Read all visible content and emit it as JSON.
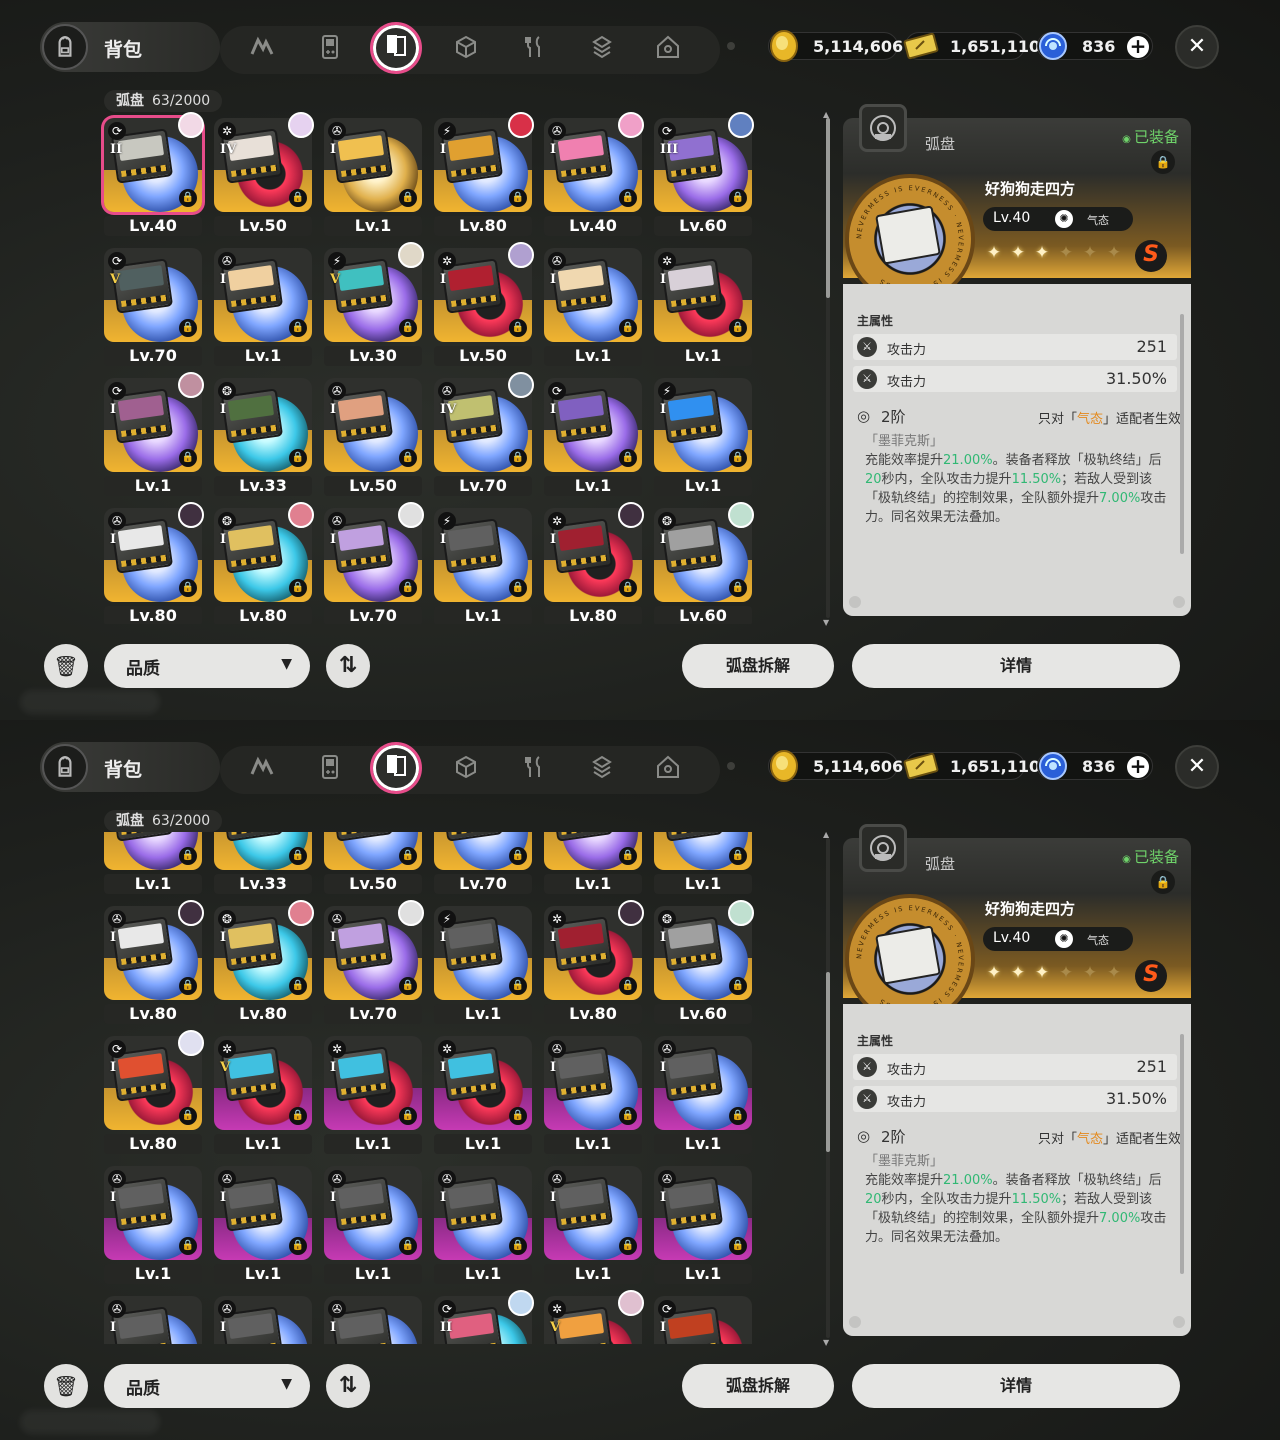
{
  "header": {
    "bag_title": "背包",
    "active_tab_index": 2,
    "tabs": [
      {
        "name": "tab-agents",
        "icon": "n-logo-icon"
      },
      {
        "name": "tab-gameboy",
        "icon": "handheld-console-icon"
      },
      {
        "name": "tab-discs",
        "icon": "disc-drive-icon"
      },
      {
        "name": "tab-materials",
        "icon": "cube-icon"
      },
      {
        "name": "tab-food",
        "icon": "fork-knife-icon"
      },
      {
        "name": "tab-cards",
        "icon": "card-stack-icon"
      },
      {
        "name": "tab-home",
        "icon": "house-icon"
      }
    ]
  },
  "currencies": [
    {
      "name": "coins",
      "icon": "gold-coin-icon",
      "value": "5,114,606"
    },
    {
      "name": "tickets",
      "icon": "ticket-icon",
      "value": "1,651,110"
    },
    {
      "name": "polychrome",
      "icon": "blue-orb-icon",
      "value": "836",
      "has_plus": true
    }
  ],
  "inventory": {
    "label": "弧盘",
    "count": "63/2000"
  },
  "panels": [
    {
      "id": "top",
      "grid_offset_rows": 0,
      "grid_row_shift": 0,
      "scroll_thumb_fraction": 0.0,
      "items": [
        {
          "level": "Lv.40",
          "tier": "II",
          "rank": "S",
          "attr": "⟳",
          "color": "blue",
          "art": "#c8c8c0",
          "avatar": "#f2d9e6",
          "selected": true
        },
        {
          "level": "Lv.50",
          "tier": "IV",
          "rank": "S",
          "attr": "✲",
          "color": "red",
          "art": "#e8e0d8",
          "avatar": "#e6d2f0"
        },
        {
          "level": "Lv.1",
          "tier": "I",
          "rank": "S",
          "attr": "✇",
          "color": "gold",
          "art": "#f0c050",
          "avatar": ""
        },
        {
          "level": "Lv.80",
          "tier": "I",
          "rank": "S",
          "attr": "⚡",
          "color": "blue",
          "art": "#e0a030",
          "avatar": "#d83048"
        },
        {
          "level": "Lv.40",
          "tier": "I",
          "rank": "S",
          "attr": "✇",
          "color": "blue",
          "art": "#f080b0",
          "avatar": "#f0a0c8"
        },
        {
          "level": "Lv.60",
          "tier": "III",
          "rank": "S",
          "attr": "⟳",
          "color": "purple",
          "art": "#9070d0",
          "avatar": "#6080c0"
        },
        {
          "level": "Lv.70",
          "tier": "V",
          "rank": "S",
          "attr": "⟳",
          "color": "blue",
          "art": "#506060",
          "avatar": ""
        },
        {
          "level": "Lv.1",
          "tier": "I",
          "rank": "S",
          "attr": "✇",
          "color": "blue",
          "art": "#f0d0a0",
          "avatar": ""
        },
        {
          "level": "Lv.30",
          "tier": "V",
          "rank": "S",
          "attr": "⚡",
          "color": "purple",
          "art": "#40c0c0",
          "avatar": "#e0d8c8"
        },
        {
          "level": "Lv.50",
          "tier": "I",
          "rank": "S",
          "attr": "✲",
          "color": "red",
          "art": "#b02030",
          "avatar": "#b0a0d0"
        },
        {
          "level": "Lv.1",
          "tier": "I",
          "rank": "S",
          "attr": "✇",
          "color": "blue",
          "art": "#f0d8b0",
          "avatar": ""
        },
        {
          "level": "Lv.1",
          "tier": "I",
          "rank": "S",
          "attr": "✲",
          "color": "red",
          "art": "#d8d0d8",
          "avatar": ""
        },
        {
          "level": "Lv.1",
          "tier": "I",
          "rank": "S",
          "attr": "⟳",
          "color": "purple",
          "art": "#a06090",
          "avatar": "#c090a0"
        },
        {
          "level": "Lv.33",
          "tier": "I",
          "rank": "S",
          "attr": "❂",
          "color": "teal",
          "art": "#507040",
          "avatar": ""
        },
        {
          "level": "Lv.50",
          "tier": "I",
          "rank": "S",
          "attr": "✇",
          "color": "blue",
          "art": "#e0a080",
          "avatar": ""
        },
        {
          "level": "Lv.70",
          "tier": "IV",
          "rank": "S",
          "attr": "✇",
          "color": "blue",
          "art": "#c0c070",
          "avatar": "#8090a0"
        },
        {
          "level": "Lv.1",
          "tier": "I",
          "rank": "S",
          "attr": "⟳",
          "color": "purple",
          "art": "#8060c0",
          "avatar": ""
        },
        {
          "level": "Lv.1",
          "tier": "I",
          "rank": "S",
          "attr": "⚡",
          "color": "blue",
          "art": "#3090f0",
          "avatar": ""
        },
        {
          "level": "Lv.80",
          "tier": "I",
          "rank": "S",
          "attr": "✇",
          "color": "blue",
          "art": "#e8e8e8",
          "avatar": "#403040"
        },
        {
          "level": "Lv.80",
          "tier": "I",
          "rank": "S",
          "attr": "❂",
          "color": "teal",
          "art": "#e0c060",
          "avatar": "#e08090"
        },
        {
          "level": "Lv.70",
          "tier": "I",
          "rank": "S",
          "attr": "✇",
          "color": "purple",
          "art": "#c0a0e0",
          "avatar": "#e0e0e0"
        },
        {
          "level": "Lv.1",
          "tier": "I",
          "rank": "S",
          "attr": "⚡",
          "color": "blue",
          "art": "#606060",
          "avatar": ""
        },
        {
          "level": "Lv.80",
          "tier": "I",
          "rank": "S",
          "attr": "✲",
          "color": "red",
          "art": "#a02030",
          "avatar": "#403040"
        },
        {
          "level": "Lv.60",
          "tier": "I",
          "rank": "S",
          "attr": "❂",
          "color": "blue",
          "art": "#a0a0a0",
          "avatar": "#c0e0d0"
        }
      ]
    },
    {
      "id": "bottom",
      "grid_offset_rows": 2,
      "scroll_thumb_fraction": 0.42,
      "items": [
        {
          "level": "Lv.1",
          "tier": "I",
          "rank": "S",
          "attr": "⟳",
          "color": "purple",
          "art": "#a06090",
          "avatar": ""
        },
        {
          "level": "Lv.33",
          "tier": "I",
          "rank": "S",
          "attr": "❂",
          "color": "teal",
          "art": "#507040",
          "avatar": ""
        },
        {
          "level": "Lv.50",
          "tier": "I",
          "rank": "S",
          "attr": "✇",
          "color": "blue",
          "art": "#e0a080",
          "avatar": ""
        },
        {
          "level": "Lv.70",
          "tier": "IV",
          "rank": "S",
          "attr": "✇",
          "color": "blue",
          "art": "#c0c070",
          "avatar": ""
        },
        {
          "level": "Lv.1",
          "tier": "I",
          "rank": "S",
          "attr": "⟳",
          "color": "purple",
          "art": "#8060c0",
          "avatar": ""
        },
        {
          "level": "Lv.1",
          "tier": "I",
          "rank": "S",
          "attr": "⚡",
          "color": "blue",
          "art": "#3090f0",
          "avatar": ""
        },
        {
          "level": "Lv.80",
          "tier": "I",
          "rank": "S",
          "attr": "✇",
          "color": "blue",
          "art": "#e8e8e8",
          "avatar": "#403040"
        },
        {
          "level": "Lv.80",
          "tier": "I",
          "rank": "S",
          "attr": "❂",
          "color": "teal",
          "art": "#e0c060",
          "avatar": "#e08090"
        },
        {
          "level": "Lv.70",
          "tier": "I",
          "rank": "S",
          "attr": "✇",
          "color": "purple",
          "art": "#c0a0e0",
          "avatar": "#e0e0e0"
        },
        {
          "level": "Lv.1",
          "tier": "I",
          "rank": "S",
          "attr": "⚡",
          "color": "blue",
          "art": "#606060",
          "avatar": ""
        },
        {
          "level": "Lv.80",
          "tier": "I",
          "rank": "S",
          "attr": "✲",
          "color": "red",
          "art": "#a02030",
          "avatar": "#403040"
        },
        {
          "level": "Lv.60",
          "tier": "I",
          "rank": "S",
          "attr": "❂",
          "color": "blue",
          "art": "#a0a0a0",
          "avatar": "#c0e0d0"
        },
        {
          "level": "Lv.80",
          "tier": "I",
          "rank": "S",
          "attr": "⟳",
          "color": "red",
          "art": "#e05030",
          "avatar": "#e0e0f0"
        },
        {
          "level": "Lv.1",
          "tier": "V",
          "rank": "A",
          "attr": "✲",
          "color": "red",
          "art": "#40c0e0",
          "avatar": ""
        },
        {
          "level": "Lv.1",
          "tier": "I",
          "rank": "A",
          "attr": "✲",
          "color": "red",
          "art": "#40c0e0",
          "avatar": ""
        },
        {
          "level": "Lv.1",
          "tier": "I",
          "rank": "A",
          "attr": "✲",
          "color": "red",
          "art": "#40c0e0",
          "avatar": ""
        },
        {
          "level": "Lv.1",
          "tier": "I",
          "rank": "A",
          "attr": "✇",
          "color": "blue",
          "art": "#606060",
          "avatar": ""
        },
        {
          "level": "Lv.1",
          "tier": "I",
          "rank": "A",
          "attr": "✇",
          "color": "blue",
          "art": "#606060",
          "avatar": ""
        },
        {
          "level": "Lv.1",
          "tier": "I",
          "rank": "A",
          "attr": "✇",
          "color": "blue",
          "art": "#606060",
          "avatar": ""
        },
        {
          "level": "Lv.1",
          "tier": "I",
          "rank": "A",
          "attr": "✇",
          "color": "blue",
          "art": "#606060",
          "avatar": ""
        },
        {
          "level": "Lv.1",
          "tier": "I",
          "rank": "A",
          "attr": "✇",
          "color": "blue",
          "art": "#606060",
          "avatar": ""
        },
        {
          "level": "Lv.1",
          "tier": "I",
          "rank": "A",
          "attr": "✇",
          "color": "blue",
          "art": "#606060",
          "avatar": ""
        },
        {
          "level": "Lv.1",
          "tier": "I",
          "rank": "A",
          "attr": "✇",
          "color": "blue",
          "art": "#606060",
          "avatar": ""
        },
        {
          "level": "Lv.1",
          "tier": "I",
          "rank": "A",
          "attr": "✇",
          "color": "blue",
          "art": "#606060",
          "avatar": ""
        },
        {
          "level": "",
          "tier": "I",
          "rank": "A",
          "attr": "✇",
          "color": "blue",
          "art": "#606060",
          "avatar": ""
        },
        {
          "level": "",
          "tier": "I",
          "rank": "A",
          "attr": "✇",
          "color": "blue",
          "art": "#606060",
          "avatar": ""
        },
        {
          "level": "",
          "tier": "I",
          "rank": "A",
          "attr": "✇",
          "color": "blue",
          "art": "#606060",
          "avatar": ""
        },
        {
          "level": "",
          "tier": "II",
          "rank": "S",
          "attr": "⟳",
          "color": "teal",
          "art": "#e06080",
          "avatar": "#c0d8f0"
        },
        {
          "level": "",
          "tier": "V",
          "rank": "S",
          "attr": "✲",
          "color": "red",
          "art": "#f0a040",
          "avatar": "#e0c0d0"
        },
        {
          "level": "",
          "tier": "I",
          "rank": "S",
          "attr": "⟳",
          "color": "red",
          "art": "#c04020",
          "avatar": ""
        }
      ]
    }
  ],
  "detail": {
    "type_label": "弧盘",
    "equipped_label": "已装备",
    "medal_ring_text": "NEVERMESS IS EVERNESS",
    "name": "好狗狗走四方",
    "level": "Lv.40",
    "attribute_name": "气态",
    "attribute_icon": "ether-swirl-icon",
    "stars_on": 3,
    "stars_total": 6,
    "rank_letter": "S",
    "section_title": "主属性",
    "stats": [
      {
        "name": "攻击力",
        "value": "251"
      },
      {
        "name": "攻击力",
        "value": "31.50%"
      }
    ],
    "set_tier": "2阶",
    "set_condition_prefix": "只对「",
    "set_condition_highlight": "气态",
    "set_condition_suffix": "」适配者生效",
    "set_name": "「墨菲克斯」",
    "desc_segments": [
      {
        "t": "充能效率提升",
        "g": false
      },
      {
        "t": "21.00%",
        "g": true
      },
      {
        "t": "。",
        "g": false
      },
      {
        "t": "装备者释放「极轨终结」后",
        "g": false
      },
      {
        "t": "20",
        "g": true
      },
      {
        "t": "秒内，全队攻击力提升",
        "g": false
      },
      {
        "t": "11.50%",
        "g": true
      },
      {
        "t": "；若敌人受到该「极轨终结」的控制效果，全队额外提升",
        "g": false
      },
      {
        "t": "7.00%",
        "g": true
      },
      {
        "t": "攻击力。同名效果无法叠加。",
        "g": false
      }
    ]
  },
  "bottom_bar": {
    "sort_label": "品质",
    "dismantle_label": "弧盘拆解",
    "details_label": "详情"
  },
  "colors": {
    "accent_pink": "#e74c8a",
    "rank_s_gold": "#f0b430",
    "rank_a_purple": "#c63ab4",
    "highlight_green": "#31b874",
    "highlight_orange": "#e38a1f",
    "equipped_green": "#6fd36a"
  }
}
